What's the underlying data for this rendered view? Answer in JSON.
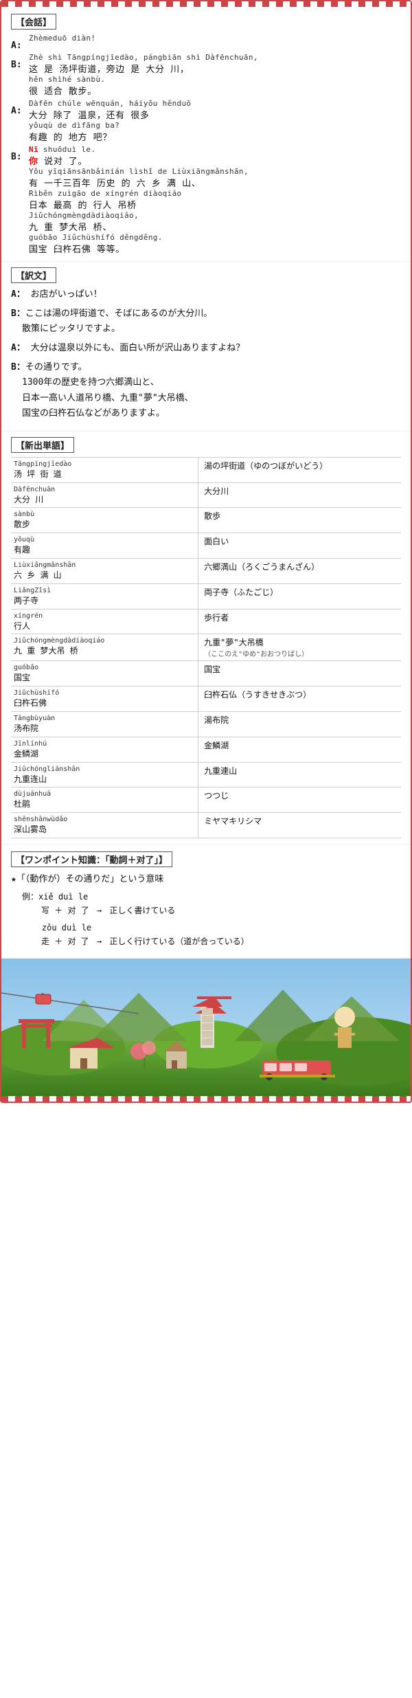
{
  "page": {
    "border_color": "#c44"
  },
  "kaiwah": {
    "label": "【会話】",
    "dialogues": [
      {
        "speaker": "A:",
        "lines": [
          {
            "pinyin": "Zhèmeduō diàn!",
            "chinese": ""
          }
        ]
      },
      {
        "speaker": "B:",
        "lines": [
          {
            "pinyin": "Zhè shì Tāngpíngjīedào, pángbiān shì Dàfēnchuān,",
            "chinese": "这  是  汤坪街道，旁边  是  大分  川，"
          },
          {
            "pinyin": "hěn shìhé sànbù.",
            "chinese": "很  适合  散步。"
          }
        ]
      },
      {
        "speaker": "A:",
        "lines": [
          {
            "pinyin": "Dàfēn chúle wēnquán, háiyǒu hěnduō",
            "chinese": "大分  除了  温泉，还有  很多"
          },
          {
            "pinyin": "yǒuqù de dìfāng ba?",
            "chinese": "有趣  的  地方  吧？"
          }
        ]
      },
      {
        "speaker": "B:",
        "lines": [
          {
            "pinyin": "Nǐ shuōduì le.",
            "chinese": "你  说对  了。",
            "highlight_you": true
          },
          {
            "pinyin": "Yǒu yīqiānsānbǎinián lìshǐ de Liùxiāngmǎnshān,",
            "chinese": "有  一千三百年  历史  的  六  乡  满  山、"
          },
          {
            "pinyin": "Rìběn zuìgāo de xíngrén diàoqiáo",
            "chinese": "日本  最高  的  行人  吊桥"
          },
          {
            "pinyin": "Jiǔchóngmèngdàdiàoqiáo,",
            "chinese": "九  重  梦大吊  桥、"
          },
          {
            "pinyin": "guóbǎo Jiǔchùshífó děngděng.",
            "chinese": "国宝  臼杵石佛  等等。"
          }
        ]
      }
    ]
  },
  "yakubun": {
    "label": "【訳文】",
    "blocks": [
      {
        "speaker": "A:",
        "lines": [
          "お店がいっぱい！"
        ]
      },
      {
        "speaker": "B:",
        "lines": [
          "ここは湯の坪街道で、そばにあるのが大分川。",
          "散策にピッタリですよ。"
        ]
      },
      {
        "speaker": "A:",
        "lines": [
          "大分は温泉以外にも、面白い所が沢山ありますよね？"
        ]
      },
      {
        "speaker": "B:",
        "lines": [
          "その通りです。",
          "1300年の歴史を持つ六郷満山と、",
          "日本一高い人道吊り橋、九重\"夢\"大吊橋、",
          "国宝の臼杵石仏などがありますよ。"
        ]
      }
    ]
  },
  "tango": {
    "label": "【新出単語】",
    "entries": [
      {
        "pinyin": "Tāngpíngjīedào\n汤  坪  街  道",
        "chinese": "汤坪街道（ゆのつぼがいどう）",
        "japanese": "湯の坪街道（ゆのつぼがいどう）"
      },
      {
        "pinyin": "Dàfēnchuān\n大分  川",
        "japanese": "大分川"
      },
      {
        "pinyin": "sànbù\n散步",
        "japanese": "散歩"
      },
      {
        "pinyin": "yǒuqù\n有趣",
        "japanese": "面白い"
      },
      {
        "pinyin": "Liùxiāngmǎnshān\n六  乡  满  山",
        "japanese": "六郷満山（ろくごうまんざん）"
      },
      {
        "pinyin": "LiǎngZǐsì\n两子寺",
        "japanese": "両子寺（ふたごじ）"
      },
      {
        "pinyin": "xíngrén\n行人",
        "japanese": "歩行者"
      },
      {
        "pinyin": "Jiǔchóngmèngdàdiàoqiáo\n九  重  梦大吊  桥",
        "japanese": "九重\"夢\"大吊橋\n（ここのえ\"ゆめ\"おおつりばし）"
      },
      {
        "pinyin": "guóbǎo\n国宝",
        "japanese": "国宝"
      },
      {
        "pinyin": "Jiǔchùshífó\n臼杵石佛",
        "japanese": "臼杵石仏（うすきせきぶつ）"
      },
      {
        "pinyin": "Tāngbùyuàn\n汤布院",
        "japanese": "湯布院"
      },
      {
        "pinyin": "Jīnlínhú\n金鳞湖",
        "japanese": "金鱗湖"
      },
      {
        "pinyin": "Jiǔchóngliánshān\n九重连山",
        "japanese": "九重連山"
      },
      {
        "pinyin": "dùjuānhuā\n杜鹃",
        "japanese": "つつじ"
      },
      {
        "pinyin": "shēnshānwùdǎo\n深山雾岛",
        "japanese": "ミヤマキリシマ"
      }
    ]
  },
  "wanpoint": {
    "label": "【ワンポイント知識：「動詞＋对了」】",
    "explanation": "★「（動作が）その通りだ」という意味",
    "examples": [
      {
        "pinyin1": "xiě  duì le",
        "formula1": "写  ＋  对  了",
        "result1": "→  正しく書けている",
        "pinyin2": "zǒu  duì le",
        "formula2": "走  ＋  对  了",
        "result2": "→  正しく行けている（道が合っている）"
      }
    ]
  }
}
